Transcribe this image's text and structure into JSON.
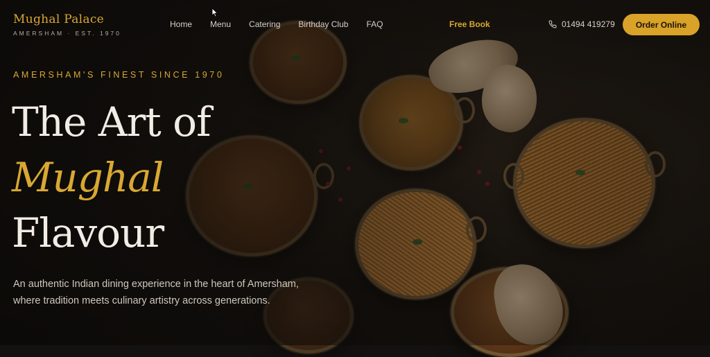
{
  "brand": {
    "name": "Mughal Palace",
    "subtitle": "AMERSHAM · EST. 1970"
  },
  "nav": {
    "links": [
      "Home",
      "Menu",
      "Catering",
      "Birthday Club",
      "FAQ"
    ],
    "free_book": "Free Book",
    "phone": "01494 419279",
    "order_button": "Order Online"
  },
  "hero": {
    "eyebrow": "AMERSHAM'S FINEST SINCE 1970",
    "headline_line1": "The Art of",
    "headline_line2": "Mughal",
    "headline_line3": "Flavour",
    "lead": "An authentic Indian dining experience in the heart of Amersham, where tradition meets culinary artistry across generations."
  },
  "colors": {
    "accent": "#d9a228",
    "background": "#141210",
    "text": "#f1ece4"
  },
  "icons": {
    "phone": "phone-icon",
    "cursor": "mouse-pointer-icon"
  }
}
